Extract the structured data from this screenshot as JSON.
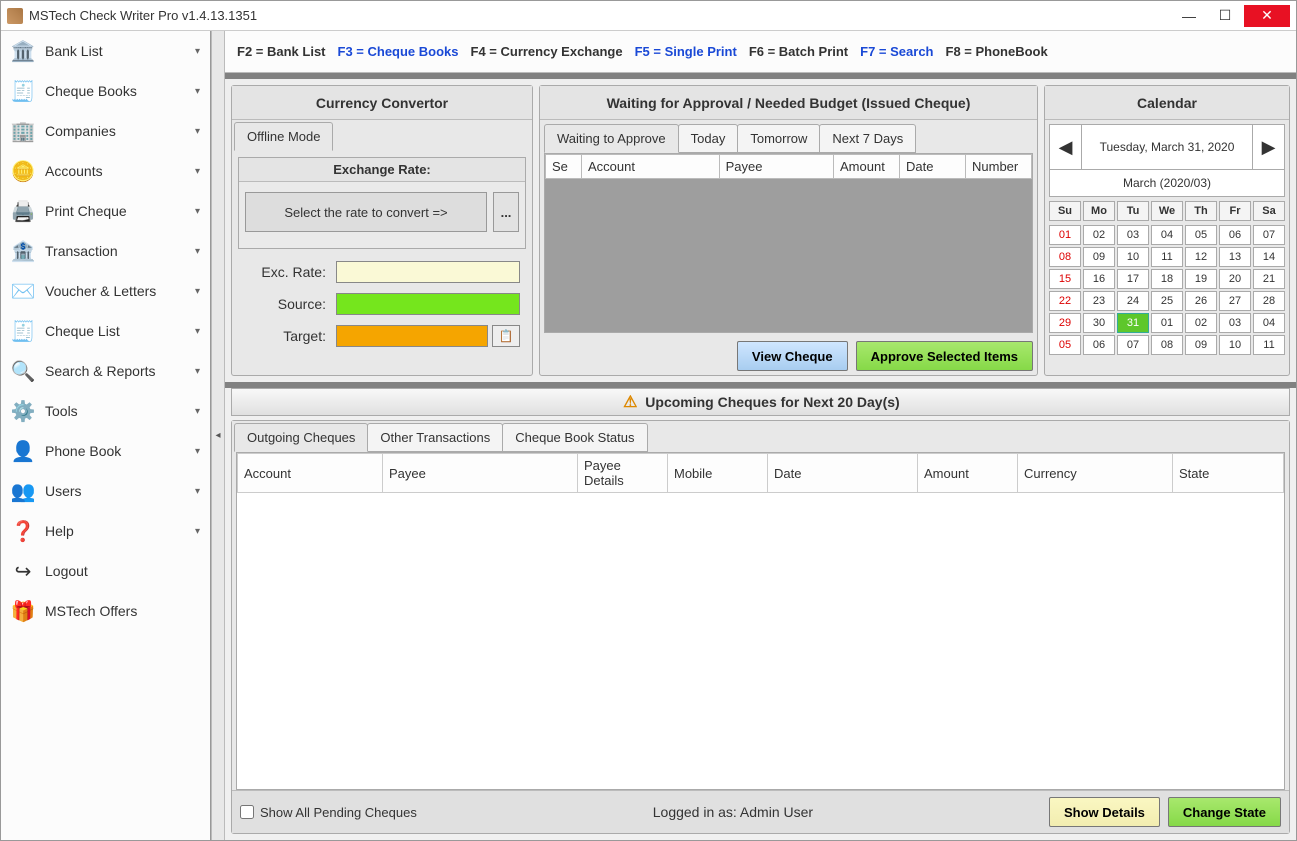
{
  "app": {
    "title": "MSTech Check Writer Pro v1.4.13.1351"
  },
  "sidebar": {
    "items": [
      {
        "label": "Bank List",
        "icon": "🏛️",
        "expandable": true
      },
      {
        "label": "Cheque Books",
        "icon": "🧾",
        "expandable": true
      },
      {
        "label": "Companies",
        "icon": "🏢",
        "expandable": true
      },
      {
        "label": "Accounts",
        "icon": "🪙",
        "expandable": true
      },
      {
        "label": "Print Cheque",
        "icon": "🖨️",
        "expandable": true
      },
      {
        "label": "Transaction",
        "icon": "🏦",
        "expandable": true
      },
      {
        "label": "Voucher & Letters",
        "icon": "✉️",
        "expandable": true
      },
      {
        "label": "Cheque List",
        "icon": "🧾",
        "expandable": true
      },
      {
        "label": "Search & Reports",
        "icon": "🔍",
        "expandable": true
      },
      {
        "label": "Tools",
        "icon": "⚙️",
        "expandable": true
      },
      {
        "label": "Phone Book",
        "icon": "👤",
        "expandable": true
      },
      {
        "label": "Users",
        "icon": "👥",
        "expandable": true
      },
      {
        "label": "Help",
        "icon": "❓",
        "expandable": true
      },
      {
        "label": "Logout",
        "icon": "↪",
        "expandable": false
      },
      {
        "label": "MSTech Offers",
        "icon": "🎁",
        "expandable": false
      }
    ]
  },
  "shortcuts": [
    {
      "text": "F2 = Bank List",
      "cls": "black"
    },
    {
      "text": "F3 = Cheque Books",
      "cls": "blue"
    },
    {
      "text": "F4 = Currency Exchange",
      "cls": "black"
    },
    {
      "text": "F5 = Single Print",
      "cls": "blue"
    },
    {
      "text": "F6 = Batch Print",
      "cls": "black"
    },
    {
      "text": "F7 = Search",
      "cls": "blue"
    },
    {
      "text": "F8 = PhoneBook",
      "cls": "black"
    }
  ],
  "currency": {
    "title": "Currency Convertor",
    "tab": "Offline Mode",
    "rateHeader": "Exchange Rate:",
    "selectPrompt": "Select the rate to convert =>",
    "moreBtn": "...",
    "labels": {
      "exc": "Exc. Rate:",
      "source": "Source:",
      "target": "Target:"
    }
  },
  "waiting": {
    "title": "Waiting for Approval / Needed Budget (Issued Cheque)",
    "tabs": [
      "Waiting to Approve",
      "Today",
      "Tomorrow",
      "Next 7 Days"
    ],
    "activeTab": 0,
    "columns": [
      "Se",
      "Account",
      "Payee",
      "Amount",
      "Date",
      "Number"
    ],
    "viewBtn": "View Cheque",
    "approveBtn": "Approve Selected Items"
  },
  "calendar": {
    "title": "Calendar",
    "current": "Tuesday, March 31, 2020",
    "month": "March   (2020/03)",
    "days": [
      "Su",
      "Mo",
      "Tu",
      "We",
      "Th",
      "Fr",
      "Sa"
    ],
    "cells": [
      {
        "d": "01",
        "cls": "red"
      },
      {
        "d": "02"
      },
      {
        "d": "03"
      },
      {
        "d": "04"
      },
      {
        "d": "05"
      },
      {
        "d": "06"
      },
      {
        "d": "07"
      },
      {
        "d": "08",
        "cls": "red"
      },
      {
        "d": "09"
      },
      {
        "d": "10"
      },
      {
        "d": "11"
      },
      {
        "d": "12"
      },
      {
        "d": "13"
      },
      {
        "d": "14"
      },
      {
        "d": "15",
        "cls": "red"
      },
      {
        "d": "16"
      },
      {
        "d": "17"
      },
      {
        "d": "18"
      },
      {
        "d": "19"
      },
      {
        "d": "20"
      },
      {
        "d": "21"
      },
      {
        "d": "22",
        "cls": "red"
      },
      {
        "d": "23"
      },
      {
        "d": "24"
      },
      {
        "d": "25"
      },
      {
        "d": "26"
      },
      {
        "d": "27"
      },
      {
        "d": "28"
      },
      {
        "d": "29",
        "cls": "red"
      },
      {
        "d": "30"
      },
      {
        "d": "31",
        "cls": "today"
      },
      {
        "d": "01"
      },
      {
        "d": "02"
      },
      {
        "d": "03"
      },
      {
        "d": "04"
      },
      {
        "d": "05",
        "cls": "red"
      },
      {
        "d": "06"
      },
      {
        "d": "07"
      },
      {
        "d": "08"
      },
      {
        "d": "09"
      },
      {
        "d": "10"
      },
      {
        "d": "11"
      }
    ]
  },
  "upcoming": {
    "header": "Upcoming Cheques for Next 20 Day(s)",
    "tabs": [
      "Outgoing Cheques",
      "Other Transactions",
      "Cheque Book Status"
    ],
    "activeTab": 0,
    "columns": [
      "Account",
      "Payee",
      "Payee Details",
      "Mobile",
      "Date",
      "Amount",
      "Currency",
      "State"
    ],
    "checkbox": "Show All Pending Cheques",
    "loggedIn": "Logged in as: Admin User",
    "showDetails": "Show Details",
    "changeState": "Change State"
  }
}
